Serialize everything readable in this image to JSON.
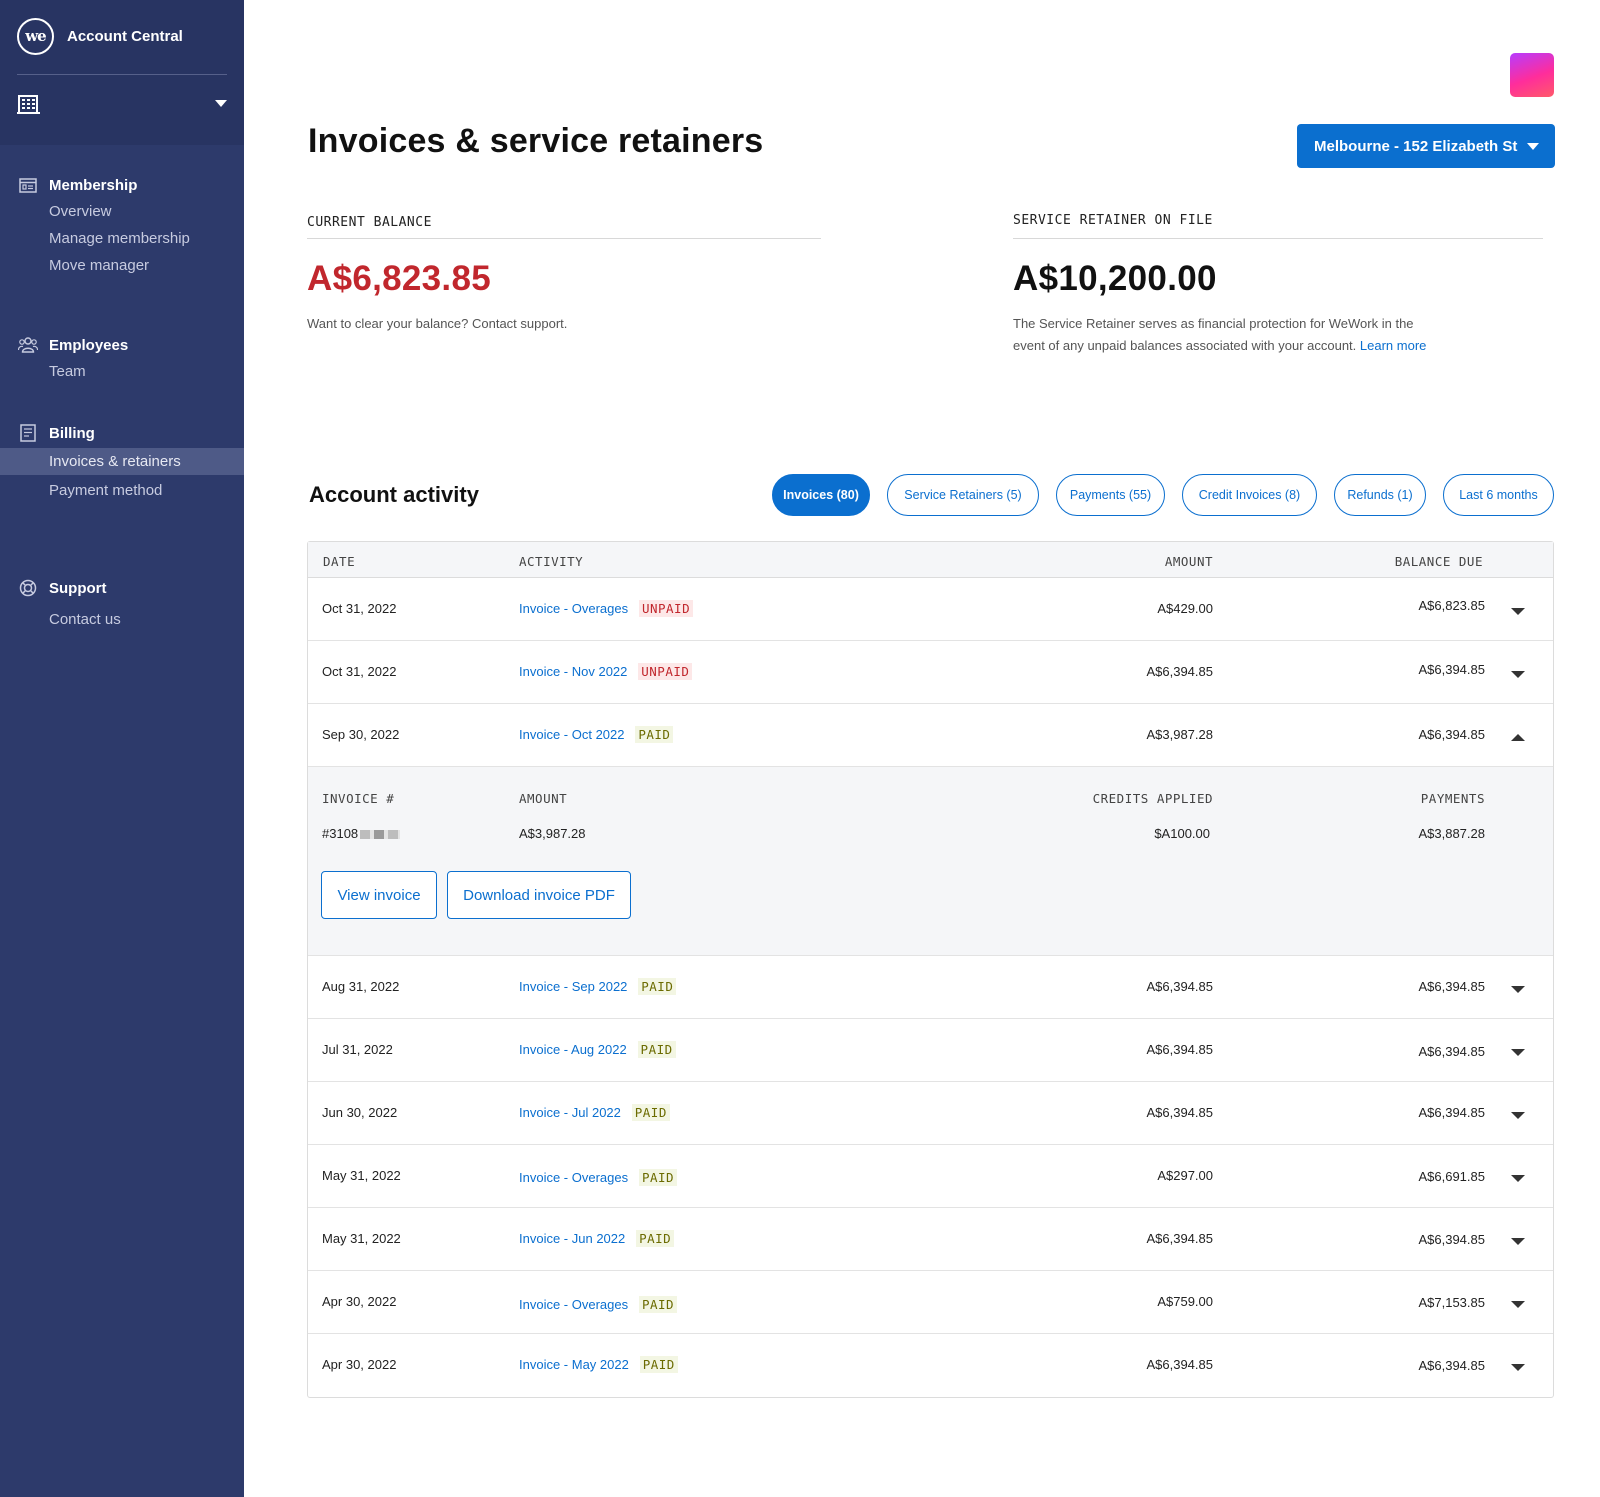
{
  "app": {
    "title": "Account Central",
    "logo_text": "we"
  },
  "sidebar": {
    "sections": [
      {
        "label": "Membership",
        "items": [
          "Overview",
          "Manage membership",
          "Move manager"
        ]
      },
      {
        "label": "Employees",
        "items": [
          "Team"
        ]
      },
      {
        "label": "Billing",
        "items": [
          "Invoices & retainers",
          "Payment method"
        ]
      },
      {
        "label": "Support",
        "items": [
          "Contact us"
        ]
      }
    ],
    "active_item": "Invoices & retainers"
  },
  "header": {
    "title": "Invoices & service retainers",
    "location": "Melbourne - 152 Elizabeth St"
  },
  "balance": {
    "label": "CURRENT BALANCE",
    "value": "A$6,823.85",
    "note": "Want to clear your balance? Contact support.",
    "value_color": "#c1272d"
  },
  "retainer": {
    "label": "SERVICE RETAINER ON FILE",
    "value": "A$10,200.00",
    "note": "The Service Retainer serves as financial protection for WeWork in the event of any unpaid balances associated with your account.",
    "link": "Learn more"
  },
  "activity": {
    "title": "Account activity",
    "filters": [
      "Invoices (80)",
      "Service Retainers (5)",
      "Payments (55)",
      "Credit Invoices (8)",
      "Refunds (1)",
      "Last 6 months"
    ],
    "active_filter": "Invoices (80)",
    "columns": {
      "date": "DATE",
      "activity": "ACTIVITY",
      "amount": "AMOUNT",
      "balance_due": "BALANCE DUE"
    },
    "rows": [
      {
        "date": "Oct 31, 2022",
        "activity": "Invoice - Overages",
        "status": "UNPAID",
        "amount": "A$429.00",
        "balance_due": "A$6,823.85",
        "expanded": false
      },
      {
        "date": "Oct 31, 2022",
        "activity": "Invoice - Nov 2022",
        "status": "UNPAID",
        "amount": "A$6,394.85",
        "balance_due": "A$6,394.85",
        "expanded": false
      },
      {
        "date": "Sep 30, 2022",
        "activity": "Invoice - Oct  2022",
        "status": "PAID",
        "amount": "A$3,987.28",
        "balance_due": "A$6,394.85",
        "expanded": true
      },
      {
        "date": "Aug 31, 2022",
        "activity": "Invoice - Sep 2022",
        "status": "PAID",
        "amount": "A$6,394.85",
        "balance_due": "A$6,394.85",
        "expanded": false
      },
      {
        "date": "Jul 31, 2022",
        "activity": "Invoice - Aug 2022",
        "status": "PAID",
        "amount": "A$6,394.85",
        "balance_due": "A$6,394.85",
        "expanded": false
      },
      {
        "date": "Jun 30, 2022",
        "activity": "Invoice - Jul 2022",
        "status": "PAID",
        "amount": "A$6,394.85",
        "balance_due": "A$6,394.85",
        "expanded": false
      },
      {
        "date": "May 31, 2022",
        "activity": "Invoice - Overages",
        "status": "PAID",
        "amount": "A$297.00",
        "balance_due": "A$6,691.85",
        "expanded": false
      },
      {
        "date": "May 31, 2022",
        "activity": "Invoice - Jun 2022",
        "status": "PAID",
        "amount": "A$6,394.85",
        "balance_due": "A$6,394.85",
        "expanded": false
      },
      {
        "date": "Apr 30, 2022",
        "activity": "Invoice - Overages",
        "status": "PAID",
        "amount": "A$759.00",
        "balance_due": "A$7,153.85",
        "expanded": false
      },
      {
        "date": "Apr 30, 2022",
        "activity": "Invoice - May 2022",
        "status": "PAID",
        "amount": "A$6,394.85",
        "balance_due": "A$6,394.85",
        "expanded": false
      }
    ],
    "detail": {
      "columns": {
        "invoice": "INVOICE #",
        "amount": "AMOUNT",
        "credits": "CREDITS APPLIED",
        "payments": "PAYMENTS"
      },
      "invoice_number": "#3108",
      "amount": "A$3,987.28",
      "credits": "$A100.00",
      "payments": "A$3,887.28",
      "view_label": "View invoice",
      "download_label": "Download invoice PDF"
    }
  },
  "colors": {
    "sidebar": "#2d3a6b",
    "accent": "#0b6fcf",
    "unpaid": "#c1272d",
    "paid": "#6b6b00"
  },
  "icons": [
    "building-icon",
    "chevron-down-icon",
    "membership-icon",
    "employees-icon",
    "billing-icon",
    "support-icon",
    "avatar"
  ]
}
